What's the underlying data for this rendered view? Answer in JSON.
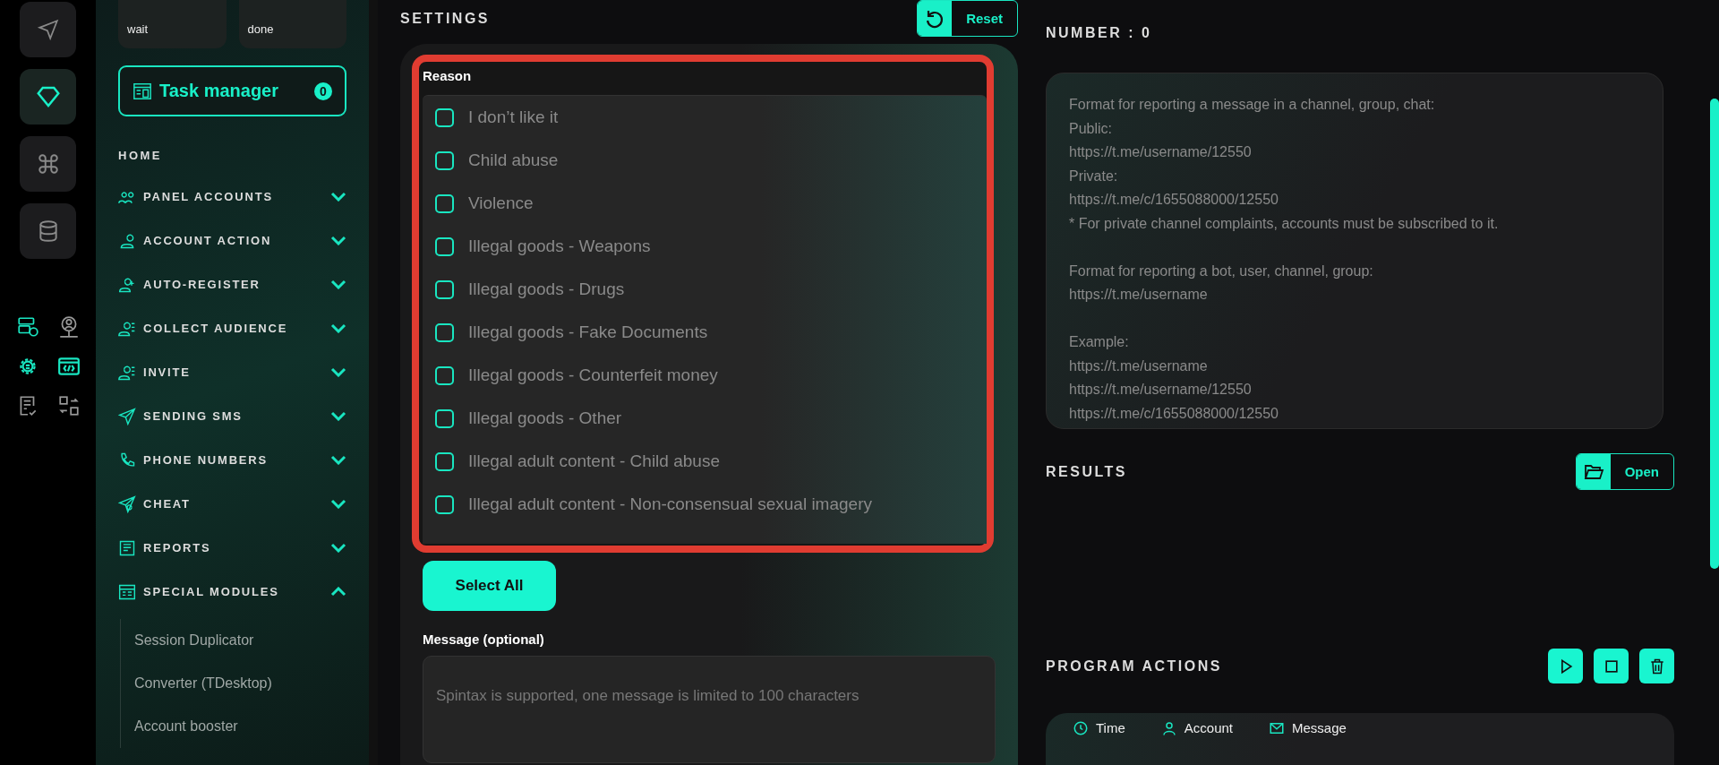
{
  "rail": {
    "tiles": [
      {
        "selected": false
      },
      {
        "selected": true
      },
      {
        "selected": false
      },
      {
        "selected": false
      }
    ]
  },
  "sidebar": {
    "stats": [
      {
        "label": "wait"
      },
      {
        "label": "done"
      }
    ],
    "task_manager": {
      "label": "Task manager",
      "count": "0"
    },
    "home": "HOME",
    "items": [
      {
        "label": "PANEL ACCOUNTS",
        "expanded": false
      },
      {
        "label": "ACCOUNT ACTION",
        "expanded": false
      },
      {
        "label": "AUTO-REGISTER",
        "expanded": false
      },
      {
        "label": "COLLECT AUDIENCE",
        "expanded": false
      },
      {
        "label": "INVITE",
        "expanded": false
      },
      {
        "label": "SENDING SMS",
        "expanded": false
      },
      {
        "label": "PHONE NUMBERS",
        "expanded": false
      },
      {
        "label": "CHEAT",
        "expanded": false
      },
      {
        "label": "REPORTS",
        "expanded": false
      },
      {
        "label": "SPECIAL MODULES",
        "expanded": true,
        "children": [
          {
            "label": "Session Duplicator"
          },
          {
            "label": "Converter (TDesktop)"
          },
          {
            "label": "Account booster"
          }
        ]
      }
    ]
  },
  "settings": {
    "title": "SETTINGS",
    "reset": "Reset",
    "reason_label": "Reason",
    "reasons": [
      {
        "label": "I don’t like it",
        "checked": false
      },
      {
        "label": "Child abuse",
        "checked": false
      },
      {
        "label": "Violence",
        "checked": false
      },
      {
        "label": "Illegal goods - Weapons",
        "checked": false
      },
      {
        "label": "Illegal goods - Drugs",
        "checked": false
      },
      {
        "label": "Illegal goods - Fake Documents",
        "checked": false
      },
      {
        "label": "Illegal goods - Counterfeit money",
        "checked": false
      },
      {
        "label": "Illegal goods - Other",
        "checked": false
      },
      {
        "label": "Illegal adult content - Child abuse",
        "checked": false
      },
      {
        "label": "Illegal adult content - Non-consensual sexual imagery",
        "checked": false
      }
    ],
    "select_all": "Select All",
    "message_label": "Message (optional)",
    "message": {
      "placeholder": "Spintax is supported, one message is limited to 100 characters"
    }
  },
  "number": {
    "title": "NUMBER : 0",
    "links": {
      "placeholder": "Format for reporting a message in a channel, group, chat:\nPublic:\nhttps://t.me/username/12550\nPrivate:\nhttps://t.me/c/1655088000/12550\n* For private channel complaints, accounts must be subscribed to it.\n\nFormat for reporting a bot, user, channel, group:\nhttps://t.me/username\n\nExample:\nhttps://t.me/username\nhttps://t.me/username/12550\nhttps://t.me/c/1655088000/12550"
    }
  },
  "results": {
    "title": "RESULTS",
    "open": "Open"
  },
  "program_actions": {
    "title": "PROGRAM ACTIONS",
    "columns": [
      "Time",
      "Account",
      "Message"
    ]
  }
}
